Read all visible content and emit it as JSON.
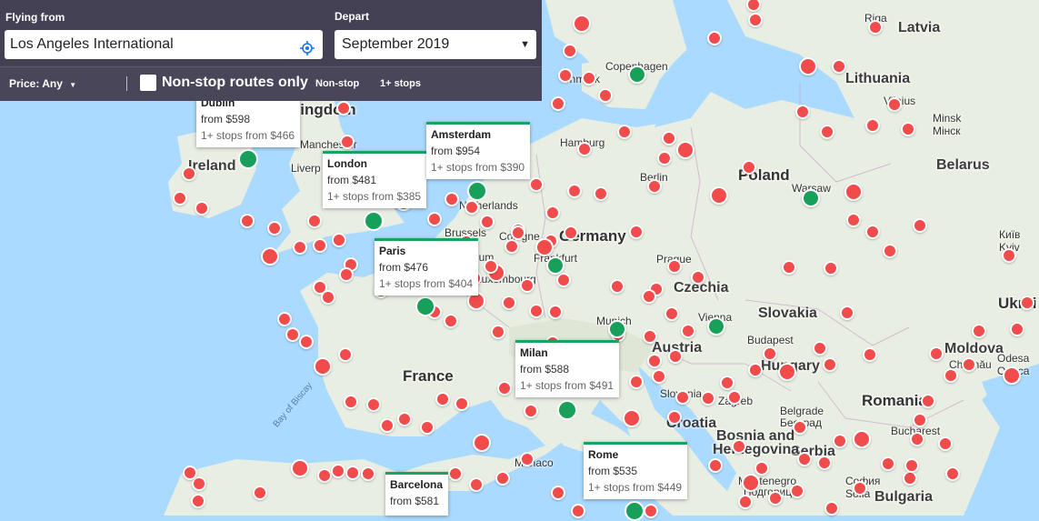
{
  "search": {
    "flying_from_label": "Flying from",
    "flying_from_value": "Los Angeles International",
    "depart_label": "Depart",
    "depart_value": "September 2019"
  },
  "filters": {
    "price_label": "Price: Any",
    "nonstop_checkbox_label": "Non-stop routes only",
    "legend_nonstop": "Non-stop",
    "legend_stops": "1+ stops"
  },
  "map_labels": [
    {
      "text": "Latvia",
      "cls": "country"
    },
    {
      "text": "Lithuania",
      "cls": "country"
    },
    {
      "text": "Belarus",
      "cls": "country"
    },
    {
      "text": "Poland",
      "cls": "big"
    },
    {
      "text": "Germany",
      "cls": "big"
    },
    {
      "text": "France",
      "cls": "big"
    },
    {
      "text": "Romania",
      "cls": "big"
    },
    {
      "text": "Ukrai",
      "cls": "big"
    },
    {
      "text": "Ireland",
      "cls": "country"
    },
    {
      "text": "Kingdom",
      "cls": "big"
    },
    {
      "text": "Czechia",
      "cls": "country"
    },
    {
      "text": "Slovakia",
      "cls": "country"
    },
    {
      "text": "Austria",
      "cls": "country"
    },
    {
      "text": "Hungary",
      "cls": "country"
    },
    {
      "text": "Serbia",
      "cls": "country"
    },
    {
      "text": "Bulgaria",
      "cls": "country"
    },
    {
      "text": "Croatia",
      "cls": "country"
    },
    {
      "text": "Bosnia and",
      "cls": "country"
    },
    {
      "text": "Herzegovina",
      "cls": "country"
    },
    {
      "text": "Moldova",
      "cls": "country"
    },
    {
      "text": "Riga",
      "cls": "city"
    },
    {
      "text": "Vilnius",
      "cls": "city"
    },
    {
      "text": "Minsk",
      "cls": "city"
    },
    {
      "text": "Мінск",
      "cls": "city"
    },
    {
      "text": "Warsaw",
      "cls": "city"
    },
    {
      "text": "Berlin",
      "cls": "city"
    },
    {
      "text": "Hamburg",
      "cls": "city"
    },
    {
      "text": "Frankfurt",
      "cls": "city"
    },
    {
      "text": "Prague",
      "cls": "city"
    },
    {
      "text": "Munich",
      "cls": "city"
    },
    {
      "text": "Vienna",
      "cls": "city"
    },
    {
      "text": "Budapest",
      "cls": "city"
    },
    {
      "text": "Zagreb",
      "cls": "city"
    },
    {
      "text": "Belgrade",
      "cls": "city"
    },
    {
      "text": "Београд",
      "cls": "city"
    },
    {
      "text": "Bucharest",
      "cls": "city"
    },
    {
      "text": "Chișinău",
      "cls": "city"
    },
    {
      "text": "Odesa",
      "cls": "city"
    },
    {
      "text": "Одеса",
      "cls": "city"
    },
    {
      "text": "Київ",
      "cls": "city"
    },
    {
      "text": "Kyiv",
      "cls": "city"
    },
    {
      "text": "Copenhagen",
      "cls": "city"
    },
    {
      "text": "enmark",
      "cls": "city"
    },
    {
      "text": "Manchester",
      "cls": "city"
    },
    {
      "text": "Liverp",
      "cls": "city"
    },
    {
      "text": "Brussels",
      "cls": "city"
    },
    {
      "text": "Belgium",
      "cls": "city"
    },
    {
      "text": "Luxembourg",
      "cls": "city"
    },
    {
      "text": "Cologne",
      "cls": "city"
    },
    {
      "text": "Netherlands",
      "cls": "city"
    },
    {
      "text": "Slovenia",
      "cls": "city"
    },
    {
      "text": "Monaco",
      "cls": "city"
    },
    {
      "text": "Montenegro",
      "cls": "city"
    },
    {
      "text": "Подгорица",
      "cls": "city"
    },
    {
      "text": "София",
      "cls": "city"
    },
    {
      "text": "Sofia",
      "cls": "city"
    },
    {
      "text": "Bay of Biscay",
      "cls": "sea"
    }
  ],
  "destinations": [
    {
      "name": "Dublin",
      "from": "from $598",
      "stops": "1+ stops from $466"
    },
    {
      "name": "London",
      "from": "from $481",
      "stops": "1+ stops from $385"
    },
    {
      "name": "Amsterdam",
      "from": "from $954",
      "stops": "1+ stops from $390"
    },
    {
      "name": "Paris",
      "from": "from $476",
      "stops": "1+ stops from $404"
    },
    {
      "name": "Milan",
      "from": "from $588",
      "stops": "1+ stops from $491"
    },
    {
      "name": "Rome",
      "from": "from $535",
      "stops": "1+ stops from $449"
    },
    {
      "name": "Barcelona",
      "from": "from $581",
      "stops": ""
    }
  ],
  "colors": {
    "panel": "#454155",
    "nonstop_pin": "#18a05a",
    "stops_dot": "#f24b4b",
    "card_accent": "#1aa260"
  }
}
